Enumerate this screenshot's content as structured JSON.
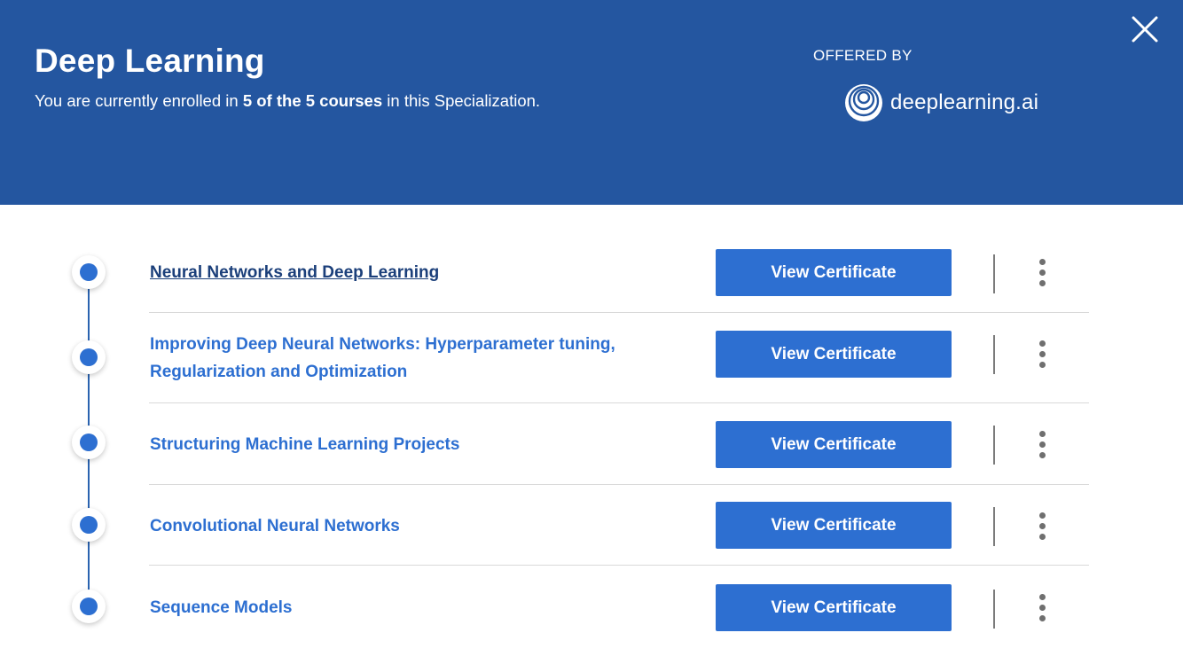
{
  "header": {
    "title": "Deep Learning",
    "subtitle_prefix": "You are currently enrolled in ",
    "subtitle_bold": "5 of the 5 courses",
    "subtitle_suffix": " in this Specialization.",
    "offered_by_label": "OFFERED BY",
    "brand_name": "deeplearning.ai",
    "close_icon": "close-icon"
  },
  "colors": {
    "header_bg": "#2456a0",
    "accent": "#2d6fd1",
    "link_visited": "#1b3f7a"
  },
  "courses": [
    {
      "title": "Neural Networks and Deep Learning",
      "button_label": "View Certificate"
    },
    {
      "title": "Improving Deep Neural Networks: Hyperparameter tuning, Regularization and Optimization",
      "button_label": "View Certificate"
    },
    {
      "title": "Structuring Machine Learning Projects",
      "button_label": "View Certificate"
    },
    {
      "title": "Convolutional Neural Networks",
      "button_label": "View Certificate"
    },
    {
      "title": "Sequence Models",
      "button_label": "View Certificate"
    }
  ],
  "icons": {
    "more": "more-vertical-icon",
    "step": "timeline-dot-icon"
  }
}
